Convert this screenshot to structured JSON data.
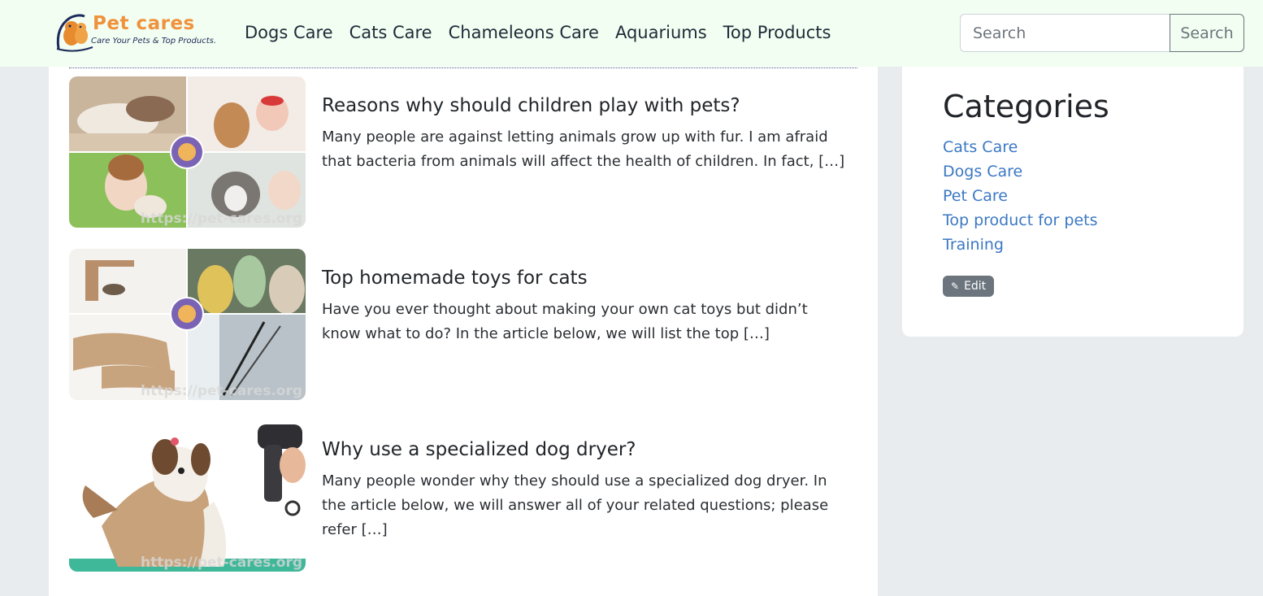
{
  "brand": {
    "name": "Pet cares",
    "tagline": "Care Your Pets & Top Products."
  },
  "nav": {
    "items": [
      {
        "label": "Dogs Care"
      },
      {
        "label": "Cats Care"
      },
      {
        "label": "Chameleons Care"
      },
      {
        "label": "Aquariums"
      },
      {
        "label": "Top Products"
      }
    ]
  },
  "search": {
    "placeholder": "Search",
    "button_label": "Search"
  },
  "posts": [
    {
      "title": "Reasons why should children play with pets?",
      "excerpt": "Many people are against letting animals grow up with fur. I am afraid that bacteria from animals will affect the health of children. In fact, […]",
      "image_watermark": "https://pet-cares.org"
    },
    {
      "title": "Top homemade toys for cats",
      "excerpt": "Have you ever thought about making your own cat toys but didn’t know what to do? In the article below, we will list the top […]",
      "image_watermark": "https://pet-cares.org"
    },
    {
      "title": "Why use a specialized dog dryer?",
      "excerpt": "Many people wonder why they should use a specialized dog dryer. In the article below, we will answer all of your related questions; please refer […]",
      "image_watermark": "https://pet-cares.org"
    }
  ],
  "sidebar": {
    "title": "Categories",
    "categories": [
      {
        "label": "Cats Care"
      },
      {
        "label": "Dogs Care"
      },
      {
        "label": "Pet Care"
      },
      {
        "label": "Top product for pets"
      },
      {
        "label": "Training"
      }
    ],
    "edit_label": "Edit",
    "edit_icon": "pencil-icon"
  },
  "colors": {
    "header_bg": "#f1fef1",
    "page_bg": "#e9ecef",
    "link": "#3b78c3",
    "brand_orange": "#f0923c",
    "badge_bg": "#6c757d"
  }
}
